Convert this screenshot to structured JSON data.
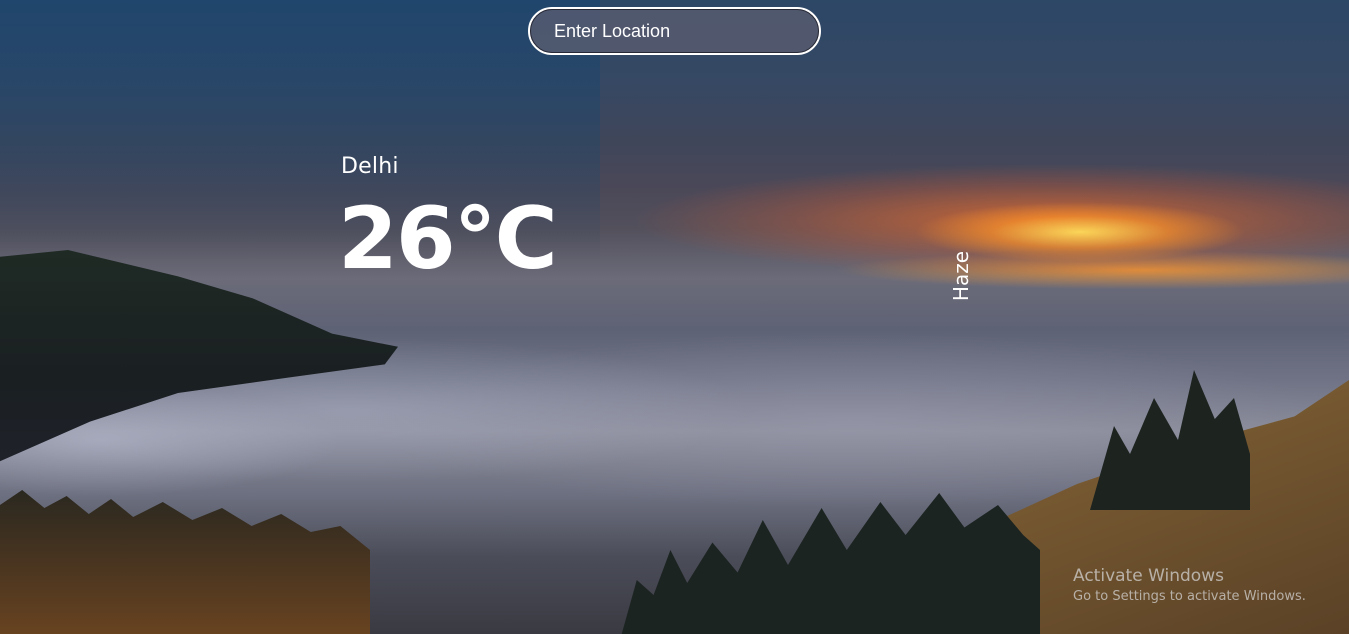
{
  "search": {
    "placeholder": "Enter Location"
  },
  "weather": {
    "city": "Delhi",
    "temperature": "26°C",
    "condition": "Haze"
  },
  "watermark": {
    "title": "Activate Windows",
    "subtitle": "Go to Settings to activate Windows."
  },
  "colors": {
    "text": "#ffffff",
    "search_bg": "#5c5e70",
    "watermark": "#d7d7d7"
  }
}
